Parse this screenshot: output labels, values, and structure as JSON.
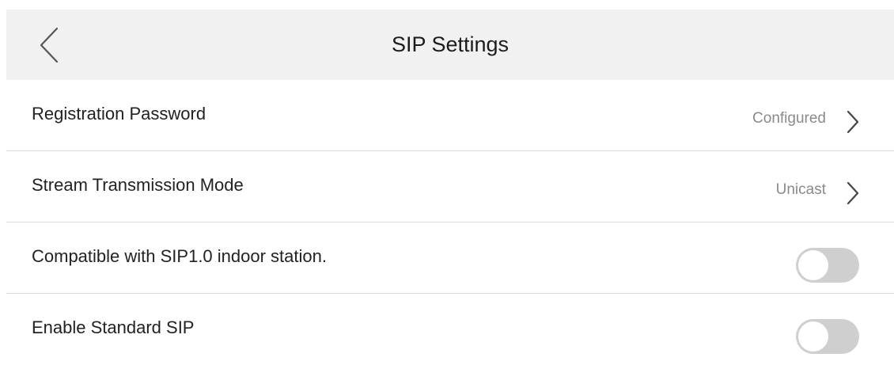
{
  "header": {
    "title": "SIP Settings",
    "back_icon": "chevron-left-icon"
  },
  "rows": [
    {
      "label": "Registration Password",
      "value": "Configured",
      "control": "chevron-right-icon"
    },
    {
      "label": "Stream Transmission Mode",
      "value": "Unicast",
      "control": "chevron-right-icon"
    },
    {
      "label": "Compatible with SIP1.0 indoor station.",
      "control": "toggle",
      "enabled": false
    },
    {
      "label": "Enable Standard SIP",
      "control": "toggle",
      "enabled": false
    }
  ],
  "colors": {
    "header_background": "#f1f1f1",
    "toggle_off": "#cfcfcf",
    "value_text": "#8a8a8a",
    "divider": "#dcdcdc"
  }
}
